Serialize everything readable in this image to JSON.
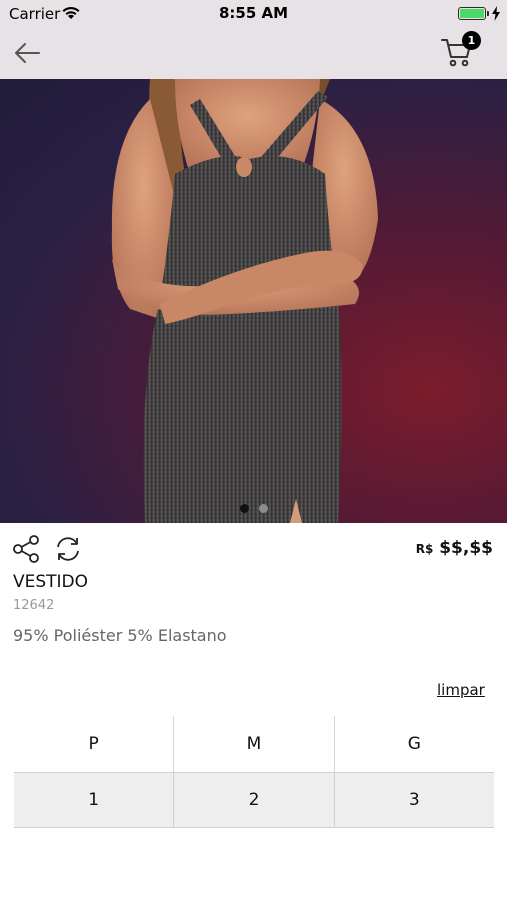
{
  "status_bar": {
    "carrier": "Carrier",
    "time": "8:55 AM"
  },
  "header": {
    "cart_count": "1"
  },
  "product": {
    "price_currency": "R$",
    "price_value": "$$,$$",
    "name": "VESTIDO",
    "code": "12642",
    "composition": "95% Poliéster 5% Elastano"
  },
  "gallery": {
    "image_count": 2,
    "active_index": 0
  },
  "sizes": {
    "clear_label": "limpar",
    "headers": [
      "P",
      "M",
      "G"
    ],
    "quantities": [
      "1",
      "2",
      "3"
    ]
  },
  "colors": {
    "accent": "#000000",
    "battery": "#4cd964",
    "header_bg": "#e7e2e5",
    "table_bg": "#eeeeee"
  }
}
